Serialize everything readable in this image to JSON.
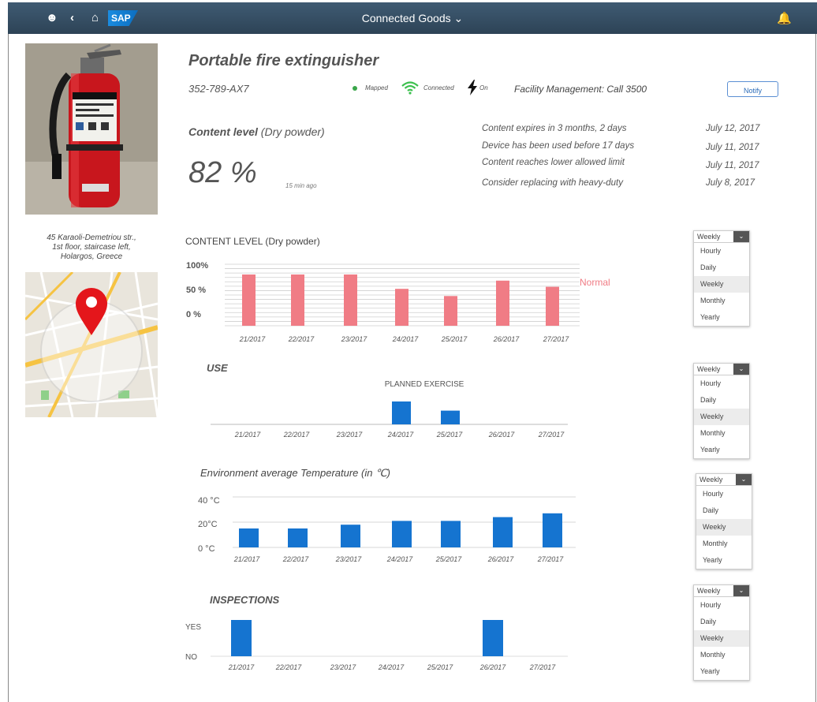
{
  "shell": {
    "title": "Connected Goods"
  },
  "product": {
    "name": "Portable fire extinguisher",
    "id": "352-789-AX7",
    "status_mapped": "Mapped",
    "status_connected": "Connected",
    "status_on": "On",
    "facility": "Facility Management: Call 3500",
    "notify_label": "Notify"
  },
  "content": {
    "label": "Content level",
    "sublabel": "(Dry powder)",
    "value": "82 %",
    "updated": "15 min ago"
  },
  "events": [
    {
      "text": "Content expires in 3 months,  2 days",
      "date": "July 12, 2017"
    },
    {
      "text": "Device has been used  before  17 days",
      "date": "July 11, 2017"
    },
    {
      "text": "Content reaches lower allowed limit",
      "date": "July 11, 2017"
    },
    {
      "text": "Consider replacing with heavy-duty",
      "date": "July 8, 2017"
    }
  ],
  "location": {
    "line1": "45 Karaoli-Demetriou   str.,",
    "line2": "1st floor, staircase left,",
    "line3": "Holargos, Greece"
  },
  "dropdown": {
    "selected": "Weekly",
    "options": [
      "Hourly",
      "Daily",
      "Weekly",
      "Monthly",
      "Yearly"
    ]
  },
  "colors": {
    "pink": "#f07c85",
    "blue": "#1574d0",
    "shell": "#354d63"
  },
  "chart_data": [
    {
      "type": "bar",
      "title": "CONTENT LEVEL (Dry powder)",
      "categories": [
        "21/2017",
        "22/2017",
        "23/2017",
        "24/2017",
        "25/2017",
        "26/2017",
        "27/2017"
      ],
      "values": [
        100,
        100,
        100,
        72,
        58,
        88,
        76
      ],
      "y_ticks": [
        "100%",
        "50 %",
        "0 %"
      ],
      "ylim": [
        0,
        120
      ],
      "annotation": "Normal",
      "grid": true,
      "color": "#f07c85"
    },
    {
      "type": "bar",
      "title": "USE",
      "annotation": "PLANNED EXERCISE",
      "categories": [
        "21/2017",
        "22/2017",
        "23/2017",
        "24/2017",
        "25/2017",
        "26/2017",
        "27/2017"
      ],
      "values": [
        0,
        0,
        0,
        1,
        0.6,
        0,
        0
      ],
      "color": "#1574d0"
    },
    {
      "type": "bar",
      "title": "Environment average Temperature (in ℃)",
      "categories": [
        "21/2017",
        "22/2017",
        "23/2017",
        "24/2017",
        "25/2017",
        "26/2017",
        "27/2017"
      ],
      "values": [
        15,
        15,
        18,
        21,
        21,
        24,
        27
      ],
      "y_ticks": [
        "40 °C",
        "20°C",
        "0 °C"
      ],
      "ylim": [
        0,
        40
      ],
      "color": "#1574d0"
    },
    {
      "type": "bar",
      "title": "INSPECTIONS",
      "categories": [
        "21/2017",
        "22/2017",
        "23/2017",
        "24/2017",
        "25/2017",
        "26/2017",
        "27/2017"
      ],
      "values": [
        1,
        0,
        0,
        0,
        0,
        1,
        0
      ],
      "y_ticks": [
        "YES",
        "NO"
      ],
      "color": "#1574d0"
    }
  ]
}
